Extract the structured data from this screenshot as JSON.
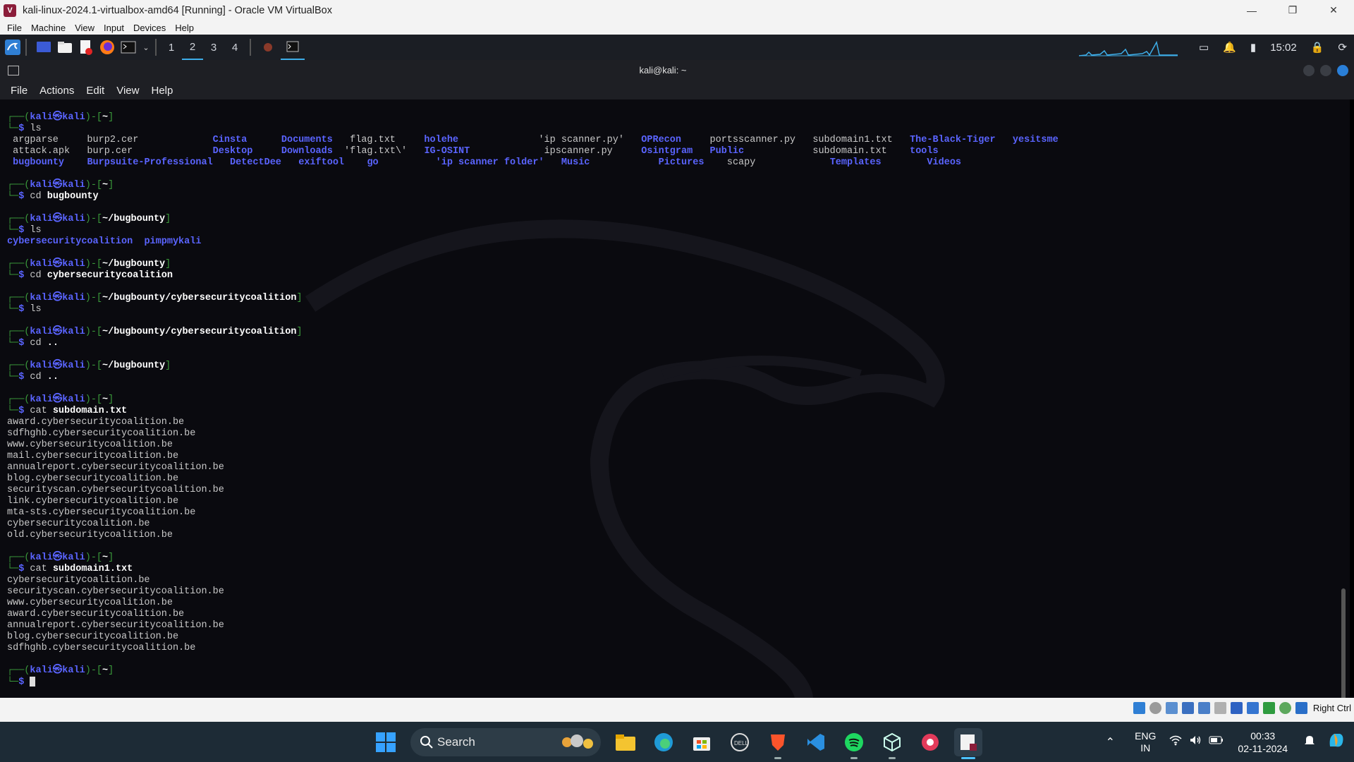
{
  "host_window": {
    "title": "kali-linux-2024.1-virtualbox-amd64 [Running] - Oracle VM VirtualBox",
    "menu": [
      "File",
      "Machine",
      "View",
      "Input",
      "Devices",
      "Help"
    ]
  },
  "kali_panel": {
    "workspaces": [
      "1",
      "2",
      "3",
      "4"
    ],
    "active_workspace": "2",
    "clock": "15:02"
  },
  "terminal": {
    "title": "kali@kali: ~",
    "menu": [
      "File",
      "Actions",
      "Edit",
      "View",
      "Help"
    ]
  },
  "vb_status": {
    "host_key": "Right Ctrl"
  },
  "taskbar": {
    "search_label": "Search",
    "lang_line1": "ENG",
    "lang_line2": "IN",
    "time": "00:33",
    "date": "02-11-2024"
  },
  "colors": {
    "prompt_green": "#3b9b3b",
    "dir_blue": "#5a64ff",
    "accent": "#4cc2ff"
  }
}
